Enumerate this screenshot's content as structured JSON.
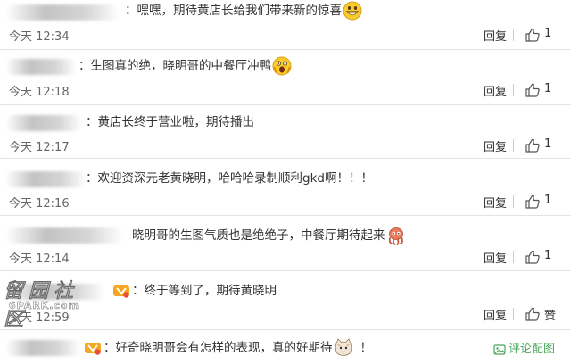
{
  "comments": [
    {
      "text": "：嘿嘿，期待黄店长给我们带来新的惊喜",
      "time": "今天 12:34",
      "reply": "回复",
      "likes": "1",
      "emoji": "grin-emoji"
    },
    {
      "text": "：生图真的绝，晓明哥的中餐厅冲鸭",
      "time": "今天 12:18",
      "reply": "回复",
      "likes": "1",
      "emoji": "shocked-emoji"
    },
    {
      "text": "：黄店长终于营业啦，期待播出",
      "time": "今天 12:17",
      "reply": "回复",
      "likes": "1"
    },
    {
      "text": "：欢迎资深元老黄晓明，哈哈哈录制顺利gkd啊！！！",
      "time": "今天 12:16",
      "reply": "回复",
      "likes": "1"
    },
    {
      "text": "晓明哥的生图气质也是绝绝子，中餐厅期待起来",
      "time": "今天 12:14",
      "reply": "回复",
      "likes": "1",
      "emoji": "octopus-emoji"
    },
    {
      "text": "：终于等到了，期待黄晓明",
      "time": "今天 12:59",
      "reply": "回复",
      "likes": "赞"
    },
    {
      "text": "：好奇晓明哥会有怎样的表现，真的好期待",
      "tail": "！",
      "emoji": "cat-emoji"
    }
  ],
  "watermark": {
    "cn": "留园社区",
    "en": "6PARK.com"
  },
  "footer": {
    "config_label": "评论配图"
  },
  "colors": {
    "green": "#4aa55a",
    "divider": "#e4e4e4"
  }
}
